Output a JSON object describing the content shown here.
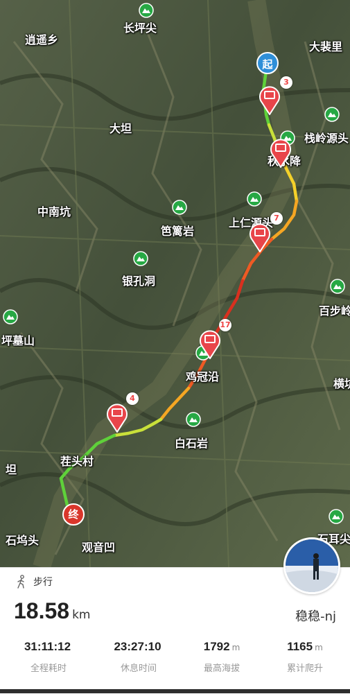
{
  "map": {
    "start_label": "起",
    "end_label": "终",
    "places": [
      {
        "id": "xiaoyaoxiang",
        "text": "逍遥乡"
      },
      {
        "id": "changpingjian",
        "text": "长坪尖"
      },
      {
        "id": "dapeili",
        "text": "大裴里"
      },
      {
        "id": "datan",
        "text": "大坦"
      },
      {
        "id": "zhanlingyuan",
        "text": "栈岭源头"
      },
      {
        "id": "qiushuijiang",
        "text": "秋水降"
      },
      {
        "id": "zhongnankeng",
        "text": "中南坑"
      },
      {
        "id": "baolianyan",
        "text": "笆篱岩"
      },
      {
        "id": "shangrenyuan",
        "text": "上仁源头"
      },
      {
        "id": "yinkongdong",
        "text": "银孔洞"
      },
      {
        "id": "baibuling",
        "text": "百步岭"
      },
      {
        "id": "muqushan",
        "text": "坪墓山"
      },
      {
        "id": "jiguanyan",
        "text": "鸡冠沿"
      },
      {
        "id": "heng",
        "text": "横坑"
      },
      {
        "id": "baishiyan",
        "text": "白石岩"
      },
      {
        "id": "zhuangtoucun",
        "text": "茬头村"
      },
      {
        "id": "tan2",
        "text": "坦"
      },
      {
        "id": "shiwutou",
        "text": "石坞头"
      },
      {
        "id": "guanyinao",
        "text": "观音凹"
      },
      {
        "id": "shi-er",
        "text": "石耳尖"
      }
    ],
    "photo_counts": [
      "3",
      "7",
      "17",
      "4"
    ]
  },
  "panel": {
    "activity_type": "步行",
    "distance_value": "18.58",
    "distance_unit": "km",
    "username": "稳稳-nj",
    "stats": [
      {
        "value": "31:11:12",
        "unit": "",
        "label": "全程耗时"
      },
      {
        "value": "23:27:10",
        "unit": "",
        "label": "休息时间"
      },
      {
        "value": "1792",
        "unit": "m",
        "label": "最高海拔"
      },
      {
        "value": "1165",
        "unit": "m",
        "label": "累计爬升"
      }
    ]
  },
  "colors": {
    "start": "#2f8fd8",
    "end": "#d9362b",
    "poi_green": "#27a844",
    "photo_pin": "#e8454a"
  },
  "icons": [
    "hiker-icon",
    "poi-mountain-icon",
    "photo-pin-icon"
  ]
}
